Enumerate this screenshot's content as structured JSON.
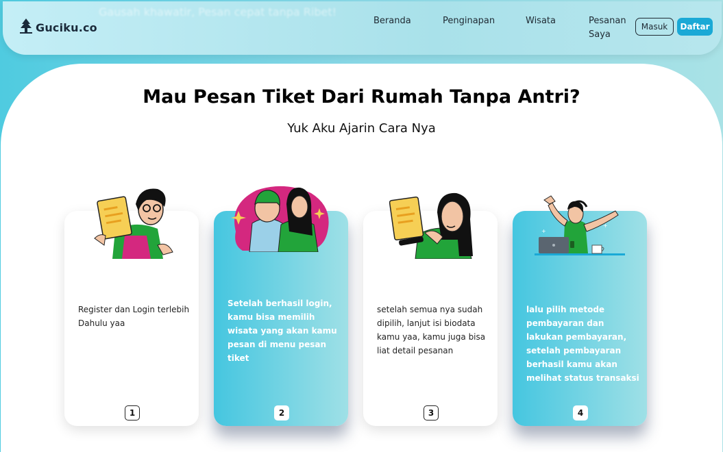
{
  "header": {
    "ghost_text": "Gausah khawatir, Pesan cepat tanpa Ribet!",
    "logo_text": "Guciku.co",
    "nav": [
      {
        "label": "Beranda"
      },
      {
        "label": "Penginapan"
      },
      {
        "label": "Wisata"
      },
      {
        "label_line1": "Pesanan",
        "label_line2": "Saya"
      }
    ],
    "login_label": "Masuk",
    "register_label": "Daftar"
  },
  "main": {
    "title": "Mau Pesan Tiket Dari Rumah Tanpa Antri?",
    "subtitle": "Yuk Aku Ajarin Cara Nya"
  },
  "steps": [
    {
      "number": "1",
      "text": "Register dan Login terlebih Dahulu yaa",
      "style": "white"
    },
    {
      "number": "2",
      "text": "Setelah berhasil login, kamu bisa memilih wisata yang akan kamu pesan di menu pesan tiket",
      "style": "blue"
    },
    {
      "number": "3",
      "text": "setelah semua nya sudah dipilih, lanjut isi biodata kamu yaa, kamu juga bisa liat detail pesanan",
      "style": "white"
    },
    {
      "number": "4",
      "text": "lalu pilih metode pembayaran dan lakukan pembayaran, setelah pembayaran berhasil kamu akan melihat status transaksi",
      "style": "blue"
    }
  ],
  "colors": {
    "accent": "#1aa9d6",
    "card_gradient_start": "#45c6e0",
    "card_gradient_end": "#9fe0e6",
    "illustration_green": "#22a43a",
    "illustration_magenta": "#d4287f",
    "illustration_yellow": "#f6cf55"
  }
}
